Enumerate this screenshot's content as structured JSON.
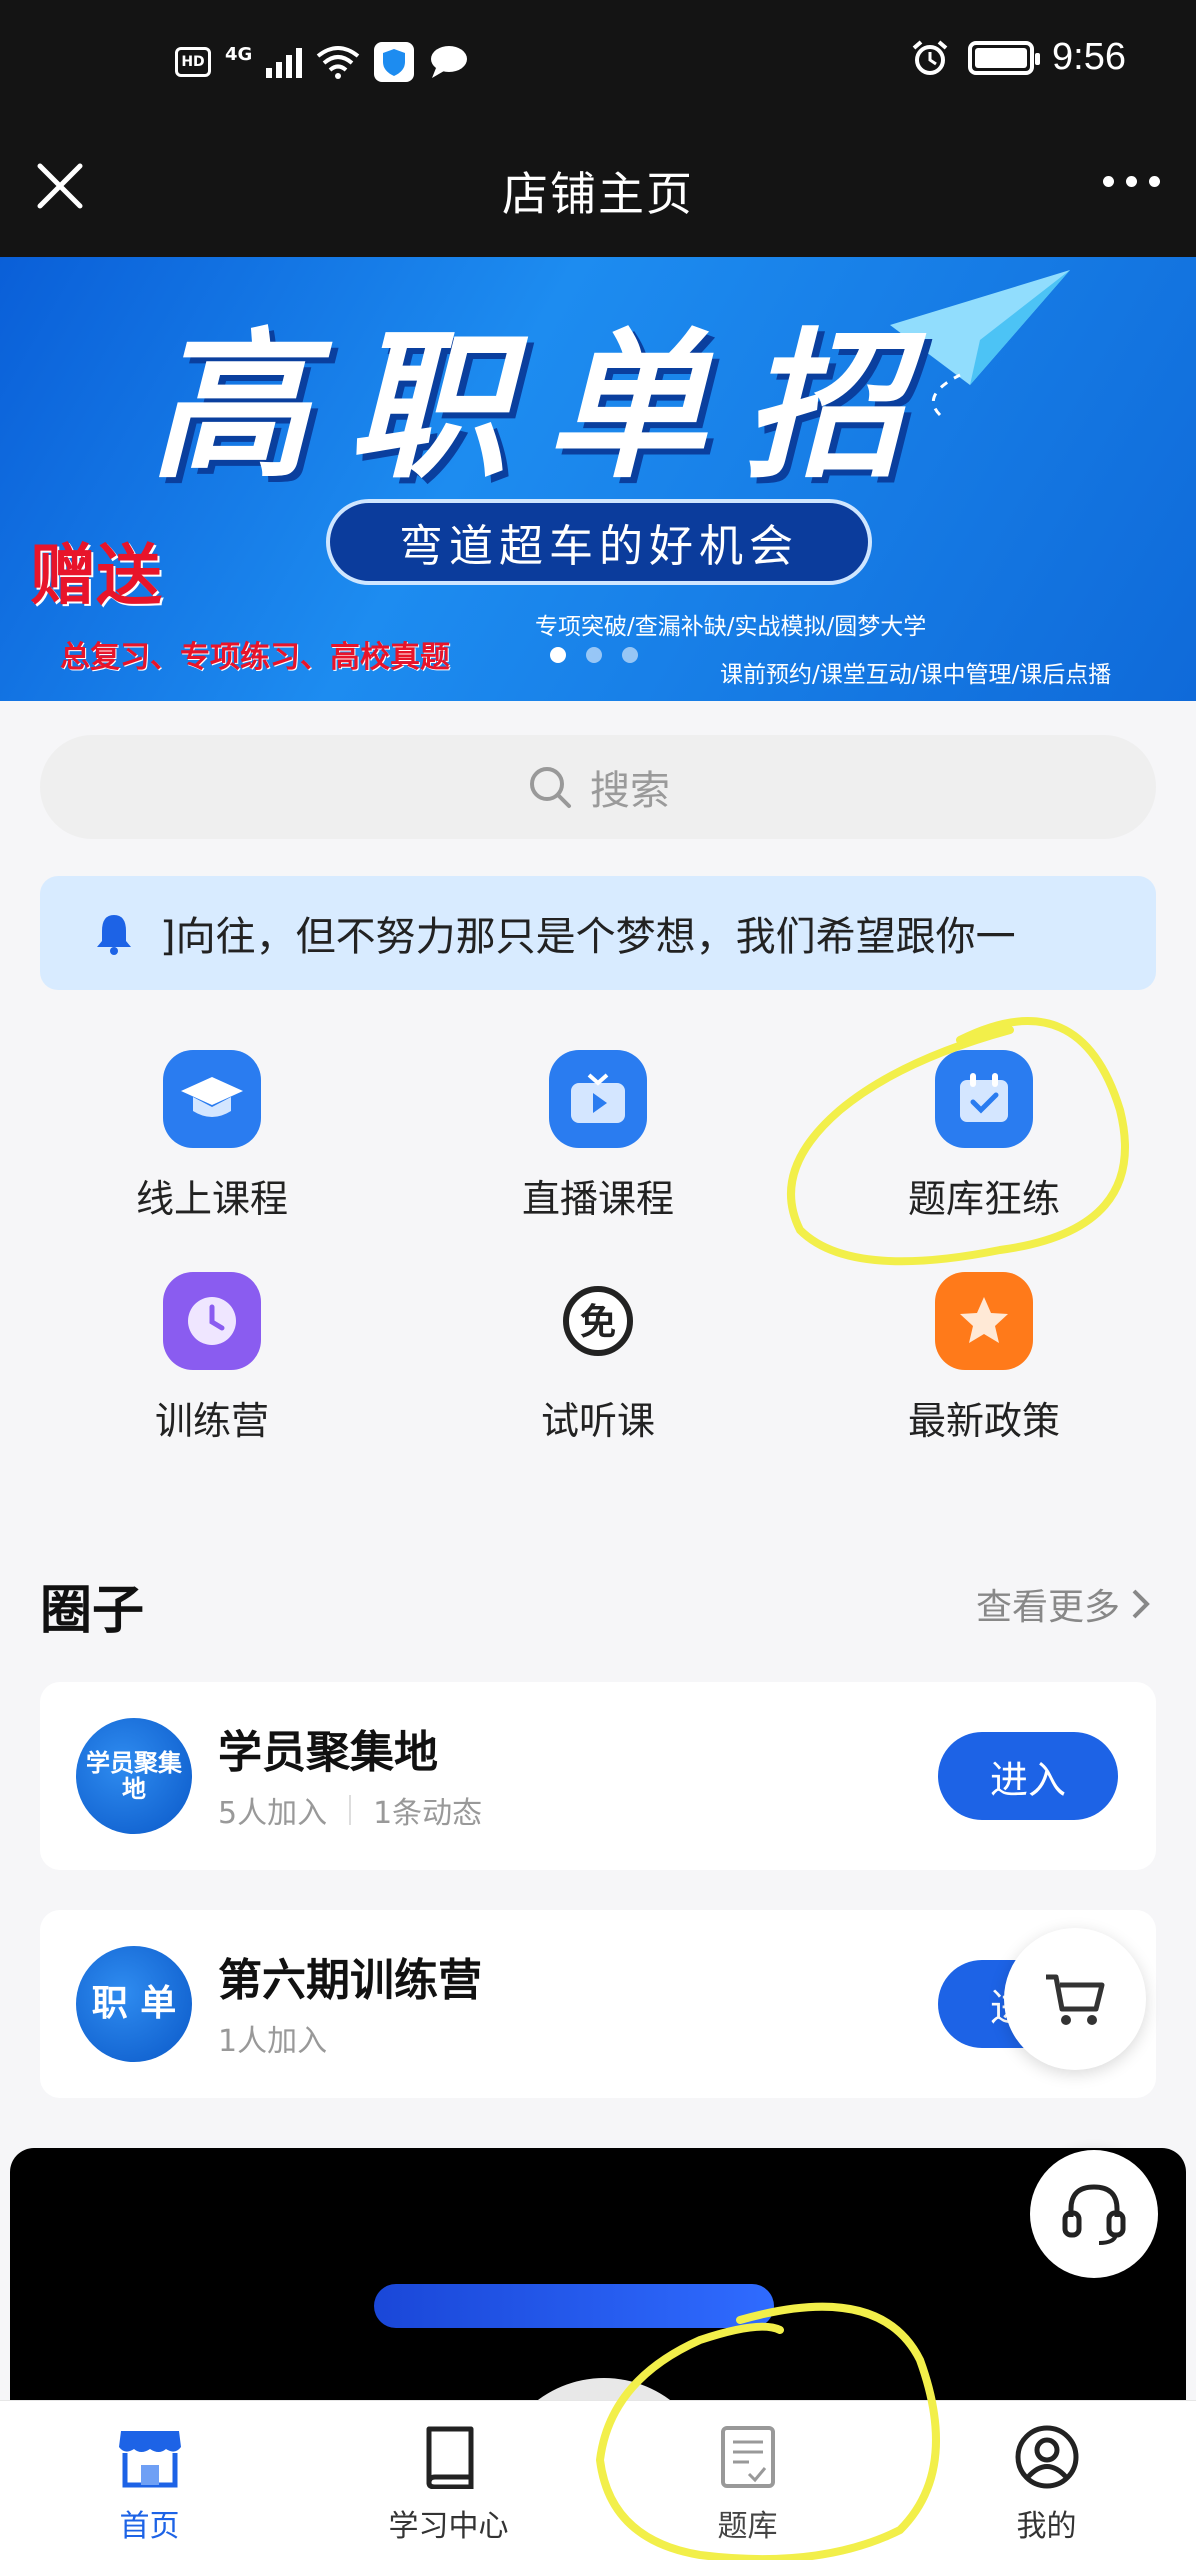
{
  "status_bar": {
    "hd": "HD",
    "network": "4G",
    "time": "9:56"
  },
  "title_bar": {
    "title": "店铺主页"
  },
  "banner": {
    "title": "高职单招",
    "pill": "弯道超车的好机会",
    "gift": "赠送",
    "gift_sub": "总复习、专项练习、高校真题",
    "tag1": "专项突破/查漏补缺/实战模拟/圆梦大学",
    "tag2": "课前预约/课堂互动/课中管理/课后点播"
  },
  "search": {
    "placeholder": "搜索"
  },
  "notice": {
    "text": "]向往，但不努力那只是个梦想，我们希望跟你一"
  },
  "grid": [
    {
      "label": "线上课程",
      "icon": "graduation-cap-icon",
      "color": "#2a7cf0"
    },
    {
      "label": "直播课程",
      "icon": "tv-play-icon",
      "color": "#2a7cf0"
    },
    {
      "label": "题库狂练",
      "icon": "calendar-check-icon",
      "color": "#2a7cf0"
    },
    {
      "label": "训练营",
      "icon": "clock-icon",
      "color": "#8a5cf0"
    },
    {
      "label": "试听课",
      "icon": "free-badge-icon",
      "color": "#222222"
    },
    {
      "label": "最新政策",
      "icon": "star-icon",
      "color": "#ff7a1a"
    }
  ],
  "circles": {
    "title": "圈子",
    "more": "查看更多",
    "items": [
      {
        "name": "学员聚集地",
        "avatar_text": "学员聚集地",
        "members": "5人加入",
        "posts": "1条动态",
        "button": "进入"
      },
      {
        "name": "第六期训练营",
        "avatar_text": "职 单",
        "members": "1人加入",
        "button": "进入"
      }
    ]
  },
  "tabbar": [
    {
      "label": "首页",
      "icon": "store-icon"
    },
    {
      "label": "学习中心",
      "icon": "book-icon"
    },
    {
      "label": "题库",
      "icon": "question-bank-icon"
    },
    {
      "label": "我的",
      "icon": "user-icon"
    }
  ],
  "colors": {
    "accent": "#1d63e6",
    "annotation": "#f2ef4a"
  }
}
